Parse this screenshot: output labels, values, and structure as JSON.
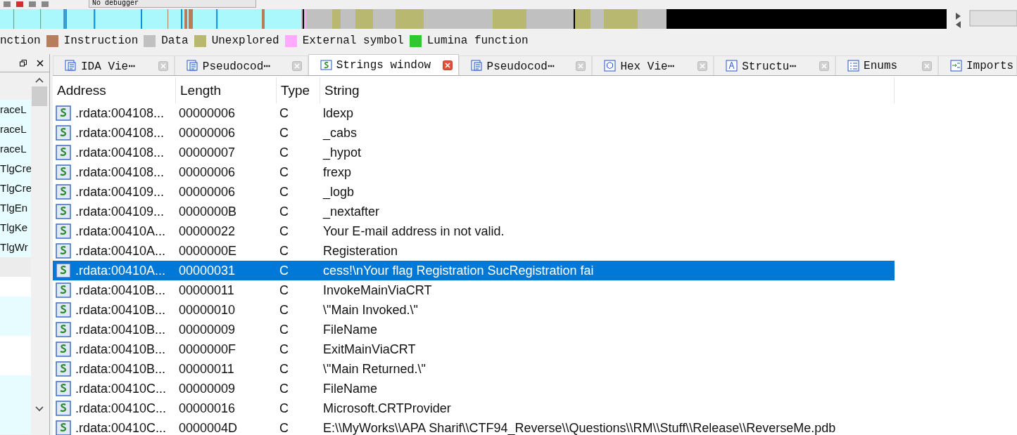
{
  "toolbar": {
    "debugger": "No debugger"
  },
  "legend": [
    {
      "label": "nction",
      "kind": "cut"
    },
    {
      "label": "Instruction",
      "color": "#b87c5a",
      "kind": "swatch"
    },
    {
      "label": "Data",
      "color": "#c0c0c0",
      "kind": "swatch"
    },
    {
      "label": "Unexplored",
      "color": "#b8b870",
      "kind": "swatch"
    },
    {
      "label": "External symbol",
      "color": "#ffaaff",
      "kind": "swatch"
    },
    {
      "label": "Lumina function",
      "color": "#30c830",
      "kind": "swatch"
    }
  ],
  "left_panel": {
    "items": [
      "raceL",
      "raceL",
      "raceL",
      "TlgCre",
      "TlgCre",
      "TlgEn",
      "TlgKe",
      "TlgWr"
    ]
  },
  "tabs": [
    {
      "label": "IDA Vie⋯",
      "kind": "ida",
      "selected": false
    },
    {
      "label": "Pseudocod⋯",
      "kind": "pseudo",
      "selected": false
    },
    {
      "label": "Strings window",
      "kind": "strings",
      "selected": true
    },
    {
      "label": "Pseudocod⋯",
      "kind": "pseudo",
      "selected": false
    },
    {
      "label": "Hex Vie⋯",
      "kind": "hex",
      "selected": false
    },
    {
      "label": "Structu⋯",
      "kind": "struct",
      "selected": false
    },
    {
      "label": "Enums",
      "kind": "enums",
      "selected": false
    },
    {
      "label": "Imports",
      "kind": "imports",
      "selected": false
    }
  ],
  "table": {
    "columns": [
      "Address",
      "Length",
      "Type",
      "String"
    ],
    "rows": [
      {
        "address": ".rdata:004108...",
        "length": "00000006",
        "type": "C",
        "string": "ldexp",
        "selected": false
      },
      {
        "address": ".rdata:004108...",
        "length": "00000006",
        "type": "C",
        "string": "_cabs",
        "selected": false
      },
      {
        "address": ".rdata:004108...",
        "length": "00000007",
        "type": "C",
        "string": "_hypot",
        "selected": false
      },
      {
        "address": ".rdata:004108...",
        "length": "00000006",
        "type": "C",
        "string": "frexp",
        "selected": false
      },
      {
        "address": ".rdata:004109...",
        "length": "00000006",
        "type": "C",
        "string": "_logb",
        "selected": false
      },
      {
        "address": ".rdata:004109...",
        "length": "0000000B",
        "type": "C",
        "string": "_nextafter",
        "selected": false
      },
      {
        "address": ".rdata:00410A...",
        "length": "00000022",
        "type": "C",
        "string": "Your E-mail address in not valid.",
        "selected": false
      },
      {
        "address": ".rdata:00410A...",
        "length": "0000000E",
        "type": "C",
        "string": "Registeration",
        "selected": false
      },
      {
        "address": ".rdata:00410A...",
        "length": "00000031",
        "type": "C",
        "string": "cess!\\nYour flag Registration SucRegistration fai",
        "selected": true
      },
      {
        "address": ".rdata:00410B...",
        "length": "00000011",
        "type": "C",
        "string": "InvokeMainViaCRT",
        "selected": false
      },
      {
        "address": ".rdata:00410B...",
        "length": "00000010",
        "type": "C",
        "string": "\\\"Main Invoked.\\\"",
        "selected": false
      },
      {
        "address": ".rdata:00410B...",
        "length": "00000009",
        "type": "C",
        "string": "FileName",
        "selected": false
      },
      {
        "address": ".rdata:00410B...",
        "length": "0000000F",
        "type": "C",
        "string": "ExitMainViaCRT",
        "selected": false
      },
      {
        "address": ".rdata:00410B...",
        "length": "00000011",
        "type": "C",
        "string": "\\\"Main Returned.\\\"",
        "selected": false
      },
      {
        "address": ".rdata:00410C...",
        "length": "00000009",
        "type": "C",
        "string": "FileName",
        "selected": false
      },
      {
        "address": ".rdata:00410C...",
        "length": "00000016",
        "type": "C",
        "string": "Microsoft.CRTProvider",
        "selected": false
      },
      {
        "address": ".rdata:00410C...",
        "length": "0000004D",
        "type": "C",
        "string": "E:\\\\MyWorks\\\\APA Sharif\\\\CTF94_Reverse\\\\Questions\\\\RM\\\\Stuff\\\\Release\\\\ReverseMe.pdb",
        "selected": false
      }
    ]
  }
}
